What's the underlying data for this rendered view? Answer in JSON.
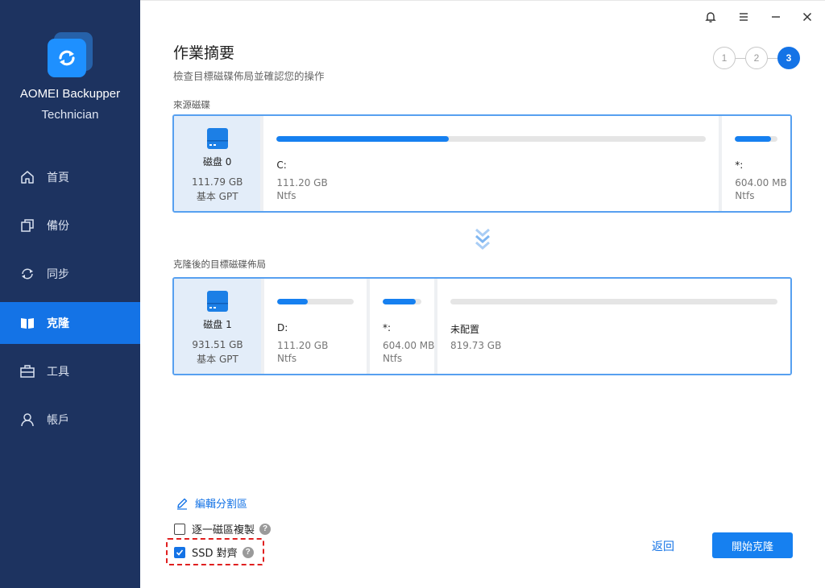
{
  "app": {
    "brand": "AOMEI Backupper",
    "edition": "Technician"
  },
  "nav": {
    "items": [
      {
        "label": "首頁",
        "icon": "home-icon"
      },
      {
        "label": "備份",
        "icon": "backup-icon"
      },
      {
        "label": "同步",
        "icon": "sync-icon"
      },
      {
        "label": "克隆",
        "icon": "clone-icon",
        "active": true
      },
      {
        "label": "工具",
        "icon": "toolbox-icon"
      },
      {
        "label": "帳戶",
        "icon": "account-icon"
      }
    ]
  },
  "window_controls": [
    "bell-icon",
    "menu-icon",
    "minimize-icon",
    "close-icon"
  ],
  "header": {
    "title": "作業摘要",
    "subtitle": "檢查目標磁碟佈局並確認您的操作",
    "steps": [
      "1",
      "2",
      "3"
    ],
    "active_step": 3
  },
  "source": {
    "label": "來源磁碟",
    "disk": {
      "name": "磁盘 0",
      "size": "111.79 GB",
      "type": "基本 GPT"
    },
    "partitions": [
      {
        "letter": "C:",
        "size": "111.20 GB",
        "fs": "Ntfs",
        "used_fraction": 0.4
      },
      {
        "letter": "*:",
        "size": "604.00 MB",
        "fs": "Ntfs",
        "used_fraction": 0.85
      }
    ]
  },
  "target": {
    "label": "克隆後的目標磁碟佈局",
    "disk": {
      "name": "磁盘 1",
      "size": "931.51 GB",
      "type": "基本 GPT"
    },
    "partitions": [
      {
        "letter": "D:",
        "size": "111.20 GB",
        "fs": "Ntfs",
        "used_fraction": 0.4
      },
      {
        "letter": "*:",
        "size": "604.00 MB",
        "fs": "Ntfs",
        "used_fraction": 0.85
      },
      {
        "letter": "未配置",
        "size": "819.73 GB",
        "fs": "",
        "used_fraction": 0
      }
    ]
  },
  "options": {
    "edit_partition": "編輯分割區",
    "sector_by_sector": {
      "label": "逐一磁區複製",
      "checked": false
    },
    "ssd_align": {
      "label": "SSD 對齊",
      "checked": true
    }
  },
  "footer": {
    "back": "返回",
    "start": "開始克隆"
  },
  "colors": {
    "sidebar_bg": "#1d3360",
    "accent": "#1473e6",
    "highlight_border": "#e02020"
  }
}
